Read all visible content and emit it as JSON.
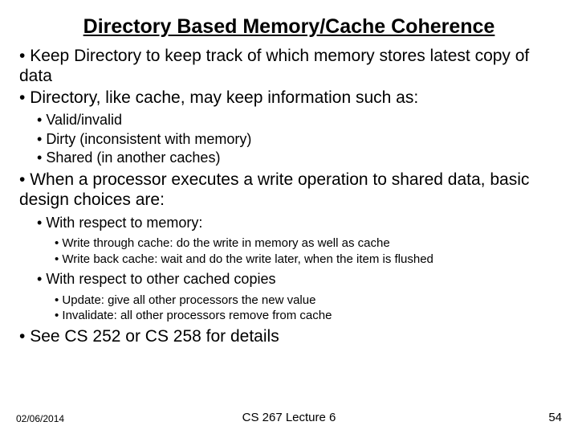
{
  "title": "Directory Based Memory/Cache Coherence",
  "bullets": {
    "b1": "Keep Directory to keep track of which memory stores latest copy of data",
    "b2": "Directory, like cache, may keep information such as:",
    "b2a": "Valid/invalid",
    "b2b": "Dirty (inconsistent with memory)",
    "b2c": "Shared (in another caches)",
    "b3": "When a processor executes a write operation to shared data, basic design choices are:",
    "b3a": "With respect to memory:",
    "b3a1": "Write through cache: do the write in memory as well as cache",
    "b3a2": "Write back cache: wait and do the write later, when the item is flushed",
    "b3b": "With respect to other cached copies",
    "b3b1": "Update: give all other processors the new value",
    "b3b2": "Invalidate: all other processors remove from cache",
    "b4": "See CS 252 or CS 258 for details"
  },
  "footer": {
    "date": "02/06/2014",
    "center": "CS 267 Lecture 6",
    "page": "54"
  }
}
